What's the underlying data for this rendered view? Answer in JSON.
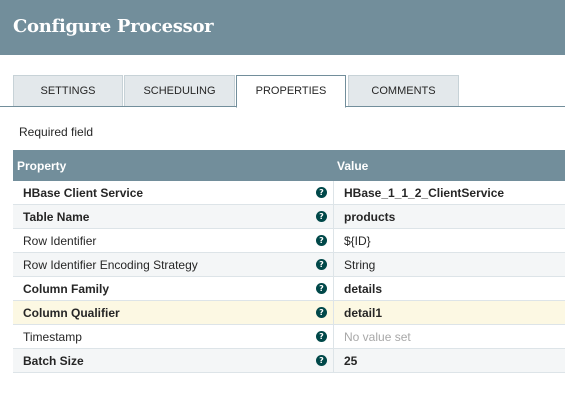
{
  "dialog": {
    "title": "Configure Processor"
  },
  "tabs": [
    {
      "label": "SETTINGS"
    },
    {
      "label": "SCHEDULING"
    },
    {
      "label": "PROPERTIES",
      "active": true
    },
    {
      "label": "COMMENTS"
    }
  ],
  "required_label": "Required field",
  "table": {
    "columns": [
      "Property",
      "Value"
    ],
    "rows": [
      {
        "name": "HBase Client Service",
        "value": "HBase_1_1_2_ClientService",
        "required": true,
        "help_icon": "question-circle-icon"
      },
      {
        "name": "Table Name",
        "value": "products",
        "required": true,
        "help_icon": "question-circle-icon"
      },
      {
        "name": "Row Identifier",
        "value": "${ID}",
        "required": false,
        "help_icon": "question-circle-icon"
      },
      {
        "name": "Row Identifier Encoding Strategy",
        "value": "String",
        "required": false,
        "help_icon": "question-circle-icon"
      },
      {
        "name": "Column Family",
        "value": "details",
        "required": true,
        "help_icon": "question-circle-icon"
      },
      {
        "name": "Column Qualifier",
        "value": "detail1",
        "required": true,
        "selected": true,
        "help_icon": "question-circle-icon"
      },
      {
        "name": "Timestamp",
        "value": "No value set",
        "required": false,
        "unset": true,
        "help_icon": "question-circle-icon"
      },
      {
        "name": "Batch Size",
        "value": "25",
        "required": true,
        "help_icon": "question-circle-icon"
      }
    ]
  },
  "colors": {
    "header": "#728e9b",
    "tab_inactive": "#e3e8eb",
    "selected_row": "#fcf8e3",
    "help_icon": "#004849"
  }
}
